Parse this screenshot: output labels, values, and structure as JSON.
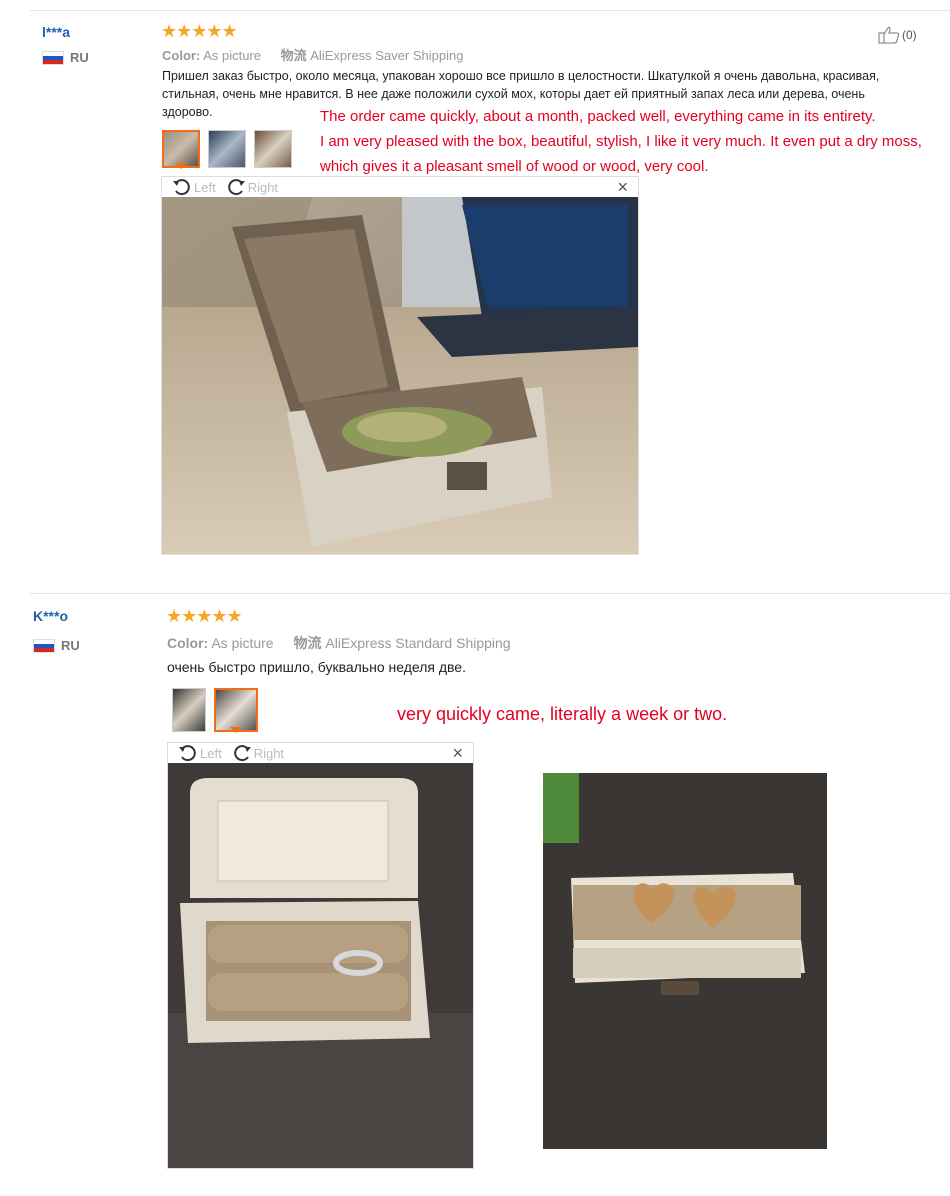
{
  "reviews": [
    {
      "user": "l***a",
      "country": "RU",
      "stars": "★★★★★",
      "color_label": "Color:",
      "color_value": "As picture",
      "logistics_label": "物流",
      "logistics_value": "AliExpress Saver Shipping",
      "like_count": "(0)",
      "text": "Пришел заказ быстро, около месяца, упакован хорошо все пришло в целостности. Шкатулкой я очень давольна, красивая, стильная, очень мне нравится. В нее даже положили сухой мох, которы дает ей приятный запах леса или дерева, очень здорово.",
      "translation": [
        "The order came quickly, about a month, packed well, everything came in its entirety.",
        "I am very pleased with the box, beautiful, stylish, I like it very much. It even put a dry moss,",
        "which gives it a pleasant smell of wood or wood, very cool."
      ],
      "viewer": {
        "left_label": "Left",
        "right_label": "Right",
        "close": "×"
      }
    },
    {
      "user": "K***o",
      "country": "RU",
      "stars": "★★★★★",
      "color_label": "Color:",
      "color_value": "As picture",
      "logistics_label": "物流",
      "logistics_value": "AliExpress Standard Shipping",
      "text": "очень быстро пришло, буквально неделя две.",
      "translation": [
        "very quickly came, literally a week or two."
      ],
      "viewer": {
        "left_label": "Left",
        "right_label": "Right",
        "close": "×"
      }
    }
  ],
  "colors": {
    "user": "#1f5fb0",
    "star": "#f5a623",
    "translation": "#e4001f",
    "selected_thumb": "#f26c1b"
  }
}
